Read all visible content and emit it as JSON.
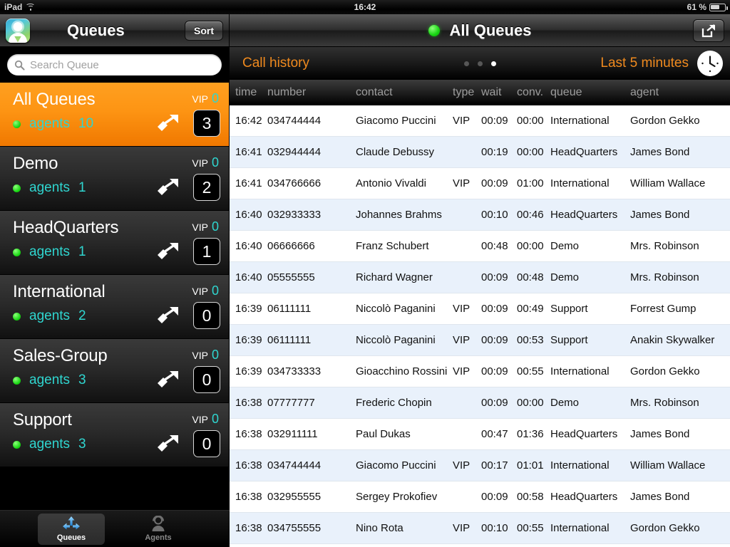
{
  "statusbar": {
    "device": "iPad",
    "time": "16:42",
    "battery": "61 %"
  },
  "nav": {
    "left_title": "Queues",
    "sort_label": "Sort",
    "right_title": "All Queues"
  },
  "search": {
    "placeholder": "Search Queue"
  },
  "queues": [
    {
      "name": "All Queues",
      "agents_label": "agents",
      "agents": "10",
      "vip_label": "VIP",
      "vip": "0",
      "count": "3",
      "selected": true
    },
    {
      "name": "Demo",
      "agents_label": "agents",
      "agents": "1",
      "vip_label": "VIP",
      "vip": "0",
      "count": "2",
      "selected": false
    },
    {
      "name": "HeadQuarters",
      "agents_label": "agents",
      "agents": "1",
      "vip_label": "VIP",
      "vip": "0",
      "count": "1",
      "selected": false
    },
    {
      "name": "International",
      "agents_label": "agents",
      "agents": "2",
      "vip_label": "VIP",
      "vip": "0",
      "count": "0",
      "selected": false
    },
    {
      "name": "Sales-Group",
      "agents_label": "agents",
      "agents": "3",
      "vip_label": "VIP",
      "vip": "0",
      "count": "0",
      "selected": false
    },
    {
      "name": "Support",
      "agents_label": "agents",
      "agents": "3",
      "vip_label": "VIP",
      "vip": "0",
      "count": "0",
      "selected": false
    }
  ],
  "tabs": [
    {
      "label": "Queues",
      "icon": "arrows-split-icon",
      "active": true
    },
    {
      "label": "Agents",
      "icon": "headset-person-icon",
      "active": false
    }
  ],
  "history": {
    "title": "Call history",
    "range": "Last 5 minutes",
    "page_dots": 3,
    "active_dot": 3,
    "accent": "#f08a1e"
  },
  "table": {
    "columns": [
      "time",
      "number",
      "contact",
      "type",
      "wait",
      "conv.",
      "queue",
      "agent"
    ],
    "rows": [
      {
        "time": "16:42",
        "number": "034744444",
        "contact": "Giacomo Puccini",
        "type": "VIP",
        "wait": "00:09",
        "conv": "00:00",
        "queue": "International",
        "agent": "Gordon Gekko"
      },
      {
        "time": "16:41",
        "number": "032944444",
        "contact": "Claude Debussy",
        "type": "",
        "wait": "00:19",
        "conv": "00:00",
        "queue": "HeadQuarters",
        "agent": "James Bond"
      },
      {
        "time": "16:41",
        "number": "034766666",
        "contact": "Antonio Vivaldi",
        "type": "VIP",
        "wait": "00:09",
        "conv": "01:00",
        "queue": "International",
        "agent": "William Wallace"
      },
      {
        "time": "16:40",
        "number": "032933333",
        "contact": "Johannes Brahms",
        "type": "",
        "wait": "00:10",
        "conv": "00:46",
        "queue": "HeadQuarters",
        "agent": "James Bond"
      },
      {
        "time": "16:40",
        "number": "06666666",
        "contact": "Franz Schubert",
        "type": "",
        "wait": "00:48",
        "conv": "00:00",
        "queue": "Demo",
        "agent": "Mrs. Robinson"
      },
      {
        "time": "16:40",
        "number": "05555555",
        "contact": "Richard Wagner",
        "type": "",
        "wait": "00:09",
        "conv": "00:48",
        "queue": "Demo",
        "agent": "Mrs. Robinson"
      },
      {
        "time": "16:39",
        "number": "06111111",
        "contact": "Niccolò Paganini",
        "type": "VIP",
        "wait": "00:09",
        "conv": "00:49",
        "queue": "Support",
        "agent": "Forrest Gump"
      },
      {
        "time": "16:39",
        "number": "06111111",
        "contact": "Niccolò Paganini",
        "type": "VIP",
        "wait": "00:09",
        "conv": "00:53",
        "queue": "Support",
        "agent": "Anakin Skywalker"
      },
      {
        "time": "16:39",
        "number": "034733333",
        "contact": "Gioacchino Rossini",
        "type": "VIP",
        "wait": "00:09",
        "conv": "00:55",
        "queue": "International",
        "agent": "Gordon Gekko"
      },
      {
        "time": "16:38",
        "number": "07777777",
        "contact": "Frederic Chopin",
        "type": "",
        "wait": "00:09",
        "conv": "00:00",
        "queue": "Demo",
        "agent": "Mrs. Robinson"
      },
      {
        "time": "16:38",
        "number": "032911111",
        "contact": "Paul Dukas",
        "type": "",
        "wait": "00:47",
        "conv": "01:36",
        "queue": "HeadQuarters",
        "agent": "James Bond"
      },
      {
        "time": "16:38",
        "number": "034744444",
        "contact": "Giacomo Puccini",
        "type": "VIP",
        "wait": "00:17",
        "conv": "01:01",
        "queue": "International",
        "agent": "William Wallace"
      },
      {
        "time": "16:38",
        "number": "032955555",
        "contact": "Sergey Prokofiev",
        "type": "",
        "wait": "00:09",
        "conv": "00:58",
        "queue": "HeadQuarters",
        "agent": "James Bond"
      },
      {
        "time": "16:38",
        "number": "034755555",
        "contact": "Nino Rota",
        "type": "VIP",
        "wait": "00:10",
        "conv": "00:55",
        "queue": "International",
        "agent": "Gordon Gekko"
      }
    ]
  }
}
